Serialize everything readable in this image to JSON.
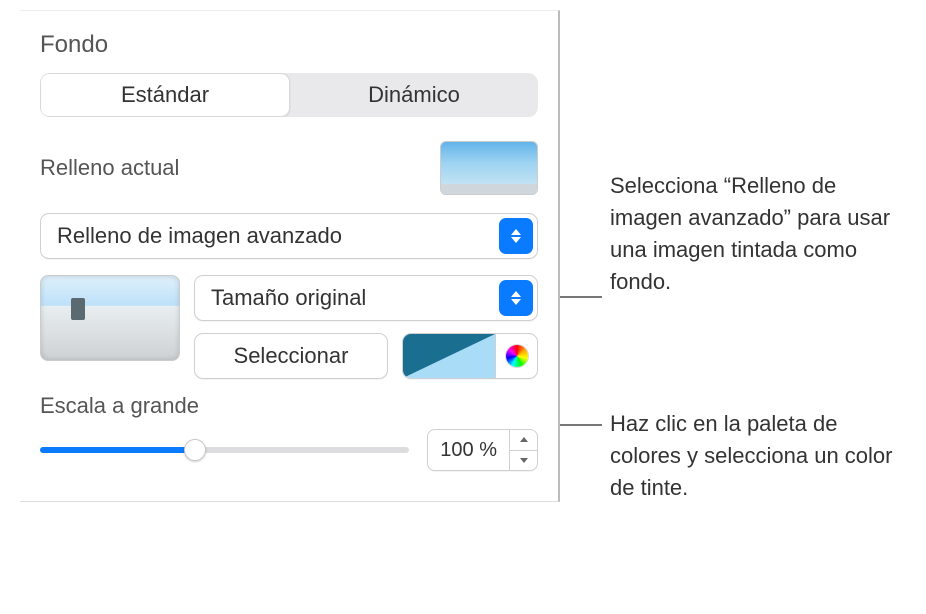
{
  "section": {
    "title": "Fondo"
  },
  "tabs": {
    "standard": "Estándar",
    "dynamic": "Dinámico"
  },
  "fill": {
    "currentLabel": "Relleno actual",
    "typeDropdown": "Relleno de imagen avanzado",
    "sizeDropdown": "Tamaño original",
    "selectButton": "Seleccionar"
  },
  "scale": {
    "label": "Escala a grande",
    "value": "100 %"
  },
  "callouts": {
    "c1": "Selecciona “Relleno de imagen avanzado” para usar una imagen tintada como fondo.",
    "c2": "Haz clic en la paleta de colores y selecciona un color de tinte."
  }
}
